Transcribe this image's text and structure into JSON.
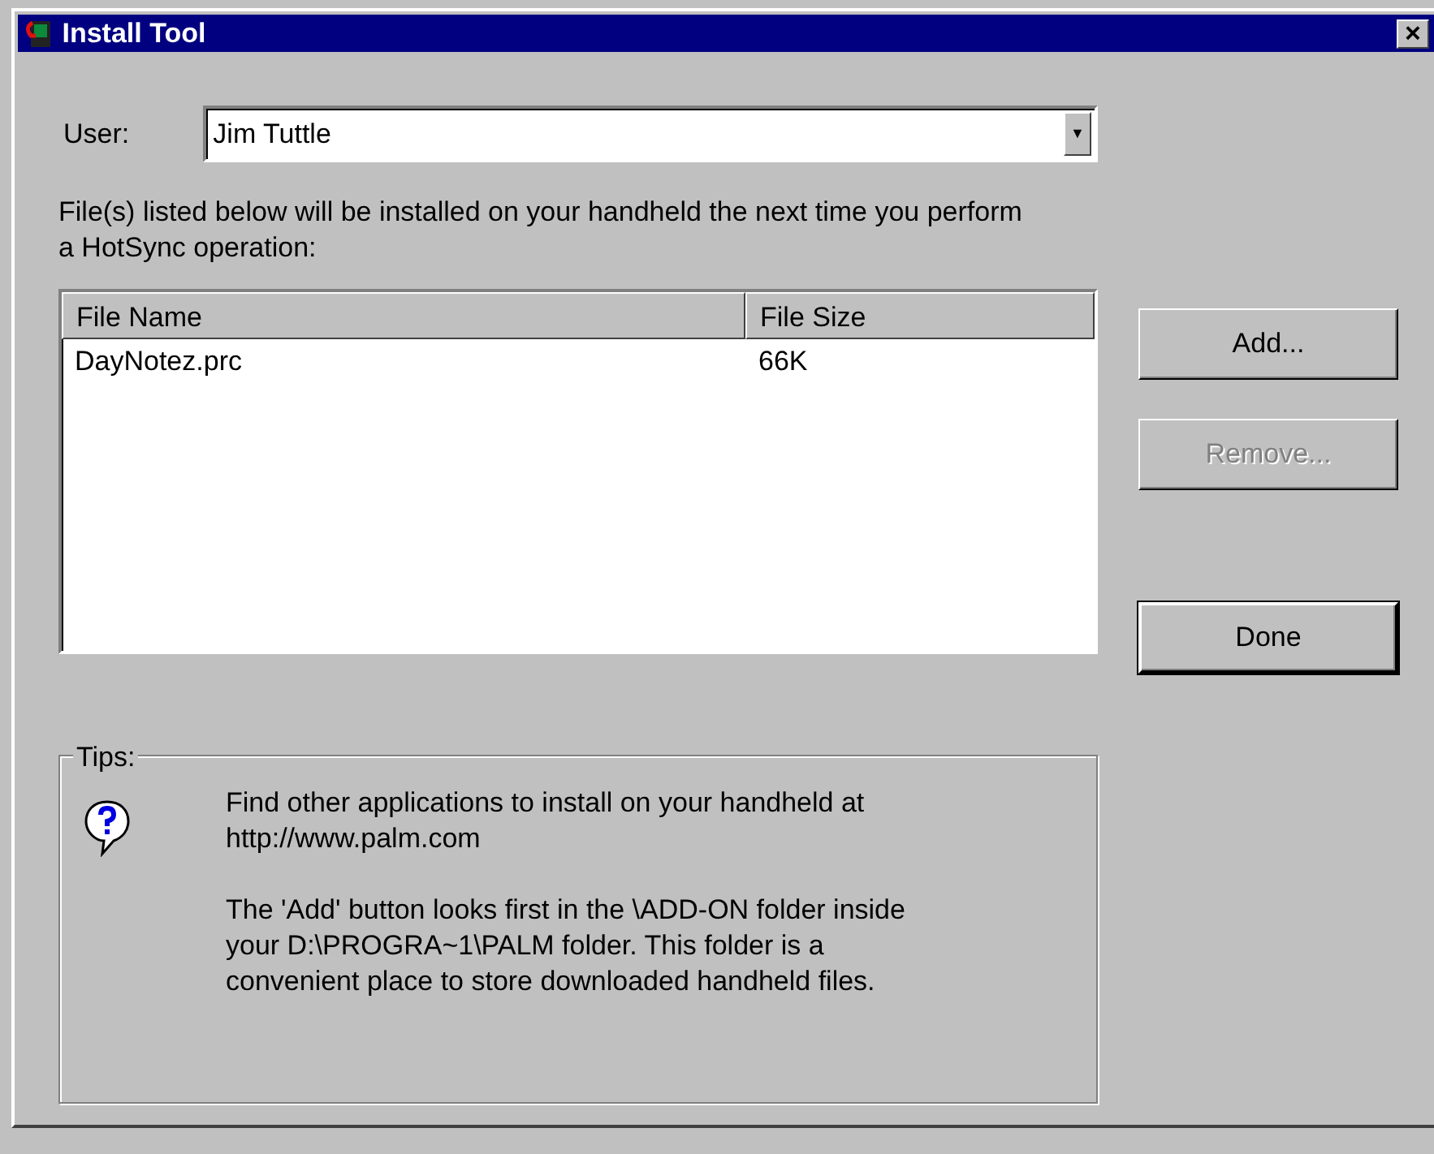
{
  "window": {
    "title": "Install Tool",
    "close": "×"
  },
  "user": {
    "label": "User:",
    "value": "Jim Tuttle",
    "arrow": "▼"
  },
  "description": "File(s) listed below will be installed on your handheld the next time you perform a HotSync operation:",
  "table": {
    "columns": [
      "File Name",
      "File Size"
    ],
    "rows": [
      [
        "DayNotez.prc",
        "66K"
      ]
    ]
  },
  "buttons": [
    {
      "label": "Add...",
      "disabled": false,
      "default": false
    },
    {
      "label": "Remove...",
      "disabled": true,
      "default": false
    },
    {
      "label": "Done",
      "disabled": false,
      "default": true
    }
  ],
  "tips": {
    "title": "Tips:",
    "paragraphs": [
      "Find other applications to install on your handheld at http://www.palm.com",
      "The 'Add' button looks first in the \\ADD-ON folder inside your D:\\PROGRA~1\\PALM folder. This folder is a convenient place to store downloaded handheld files."
    ]
  }
}
